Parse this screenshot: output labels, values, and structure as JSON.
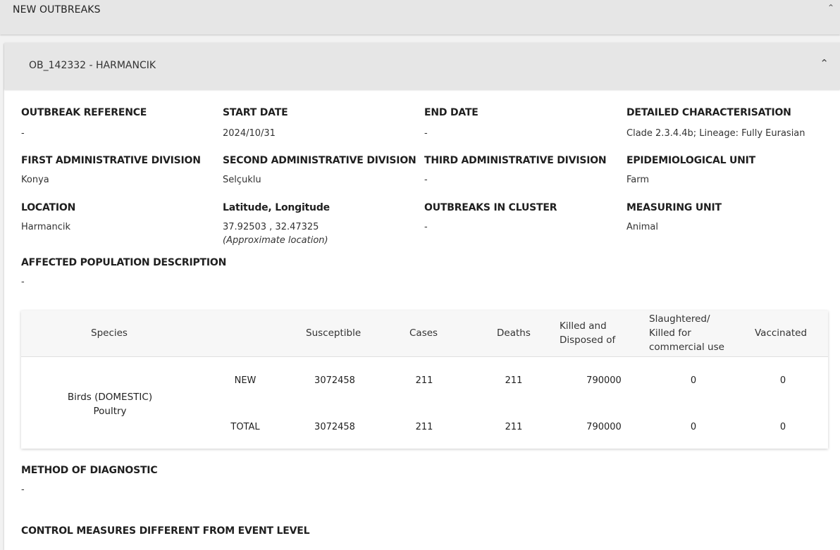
{
  "top": {
    "title": "NEW OUTBREAKS"
  },
  "outbreak": {
    "title": "OB_142332 - HARMANCIK",
    "fields": {
      "outbreak_reference": {
        "label": "OUTBREAK REFERENCE",
        "value": "-"
      },
      "start_date": {
        "label": "START DATE",
        "value": "2024/10/31"
      },
      "end_date": {
        "label": "END DATE",
        "value": "-"
      },
      "detailed_characterisation": {
        "label": "DETAILED CHARACTERISATION",
        "value": "Clade 2.3.4.4b; Lineage: Fully Eurasian"
      },
      "first_admin": {
        "label": "FIRST ADMINISTRATIVE DIVISION",
        "value": "Konya"
      },
      "second_admin": {
        "label": "SECOND ADMINISTRATIVE DIVISION",
        "value": "Selçuklu"
      },
      "third_admin": {
        "label": "THIRD ADMINISTRATIVE DIVISION",
        "value": "-"
      },
      "epi_unit": {
        "label": "EPIDEMIOLOGICAL UNIT",
        "value": "Farm"
      },
      "location": {
        "label": "LOCATION",
        "value": "Harmancik"
      },
      "lat_long": {
        "label": "Latitude, Longitude",
        "value": "37.92503 , 32.47325",
        "note": "(Approximate location)"
      },
      "outbreaks_in_cluster": {
        "label": "OUTBREAKS IN CLUSTER",
        "value": "-"
      },
      "measuring_unit": {
        "label": "MEASURING UNIT",
        "value": "Animal"
      },
      "affected_population": {
        "label": "AFFECTED POPULATION DESCRIPTION",
        "value": "-"
      },
      "method_of_diagnostic": {
        "label": "METHOD OF DIAGNOSTIC",
        "value": "-"
      },
      "control_measures": {
        "label": "CONTROL MEASURES DIFFERENT FROM EVENT LEVEL"
      }
    },
    "table": {
      "headers": {
        "species": "Species",
        "susceptible": "Susceptible",
        "cases": "Cases",
        "deaths": "Deaths",
        "killed_1": "Killed and",
        "killed_2": "Disposed of",
        "slaughtered_1": "Slaughtered/",
        "slaughtered_2": "Killed for",
        "slaughtered_3": "commercial use",
        "vaccinated": "Vaccinated"
      },
      "species_line1": "Birds (DOMESTIC)",
      "species_line2": "Poultry",
      "rows": [
        {
          "type": "NEW",
          "susceptible": "3072458",
          "cases": "211",
          "deaths": "211",
          "killed": "790000",
          "slaughtered": "0",
          "vaccinated": "0"
        },
        {
          "type": "TOTAL",
          "susceptible": "3072458",
          "cases": "211",
          "deaths": "211",
          "killed": "790000",
          "slaughtered": "0",
          "vaccinated": "0"
        }
      ]
    }
  },
  "icons": {
    "chevron_up": "chevron-up-icon"
  }
}
